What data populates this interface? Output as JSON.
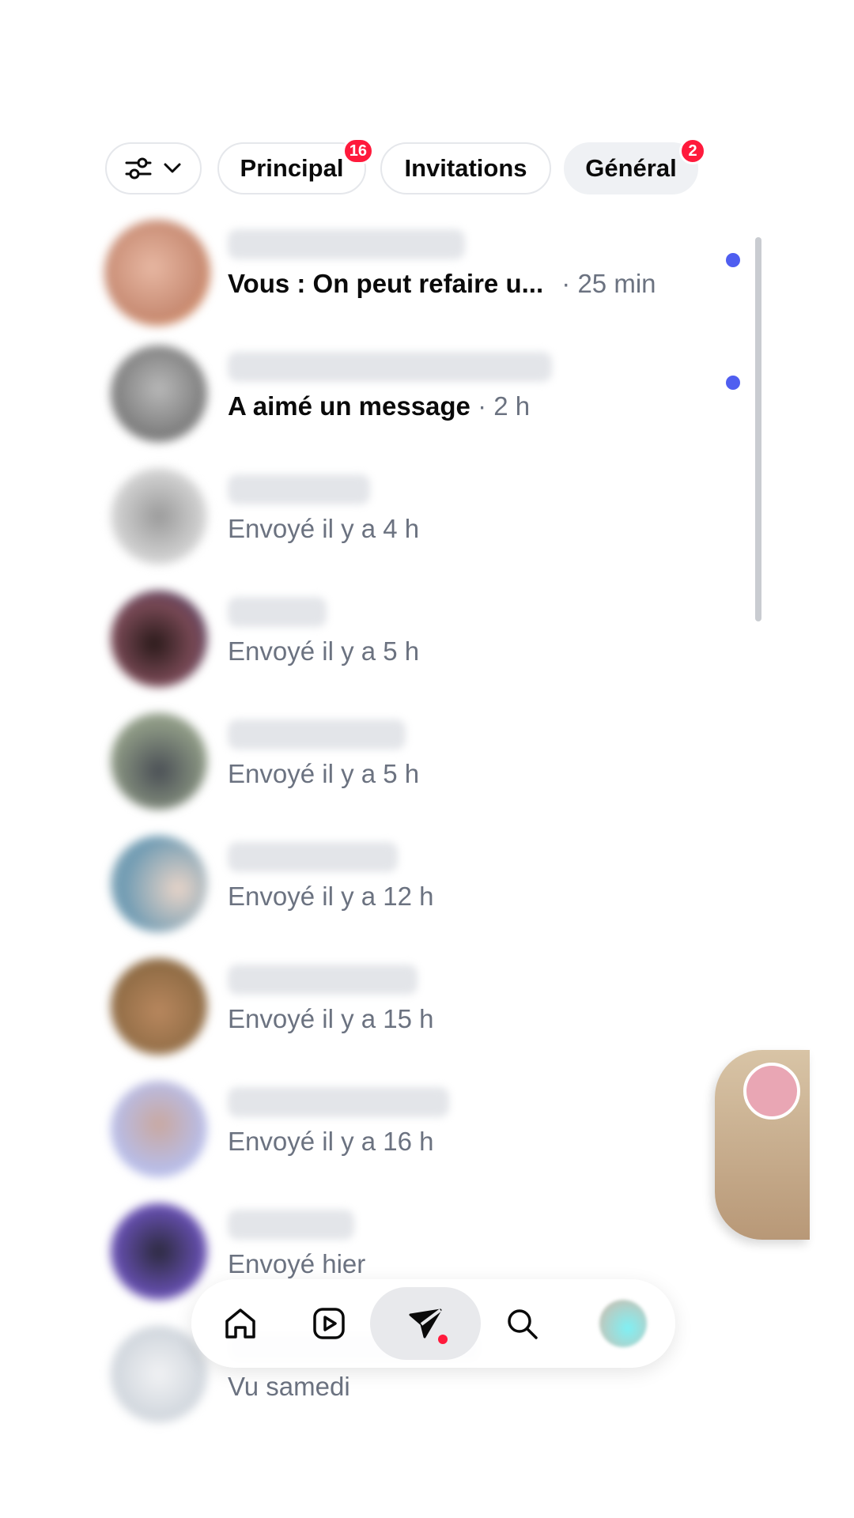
{
  "filters": {
    "filter_icon": "sliders-icon",
    "chevron_icon": "chevron-down-icon",
    "chips": [
      {
        "label": "Principal",
        "badge": "16"
      },
      {
        "label": "Invitations",
        "badge": ""
      },
      {
        "label": "Général",
        "badge": "2",
        "active": true
      }
    ]
  },
  "conversations": [
    {
      "preview": "Vous : On peut refaire u...",
      "time": " · 25 min",
      "unread": true,
      "avatar_color": "#d9a58e"
    },
    {
      "preview": "A aimé un message",
      "time": " · 2 h",
      "unread": true,
      "avatar_color": "#8f8f8f"
    },
    {
      "preview": "Envoyé il y a 4 h",
      "time": "",
      "unread": false,
      "avatar_color": "#bdbdbd"
    },
    {
      "preview": "Envoyé il y a 5 h",
      "time": "",
      "unread": false,
      "avatar_color": "#5a3a40"
    },
    {
      "preview": "Envoyé il y a 5 h",
      "time": "",
      "unread": false,
      "avatar_color": "#6f756c"
    },
    {
      "preview": "Envoyé il y a 12 h",
      "time": "",
      "unread": false,
      "avatar_color": "#7f98a8"
    },
    {
      "preview": "Envoyé il y a 15 h",
      "time": "",
      "unread": false,
      "avatar_color": "#a57b55"
    },
    {
      "preview": "Envoyé il y a 16 h",
      "time": "",
      "unread": false,
      "avatar_color": "#b6a7b0"
    },
    {
      "preview": "Envoyé hier",
      "time": "",
      "unread": false,
      "avatar_color": "#5b4a8c"
    },
    {
      "preview": "Vu samedi",
      "time": "",
      "unread": false,
      "avatar_color": "#d7dbe2"
    }
  ],
  "nav": {
    "items": [
      "home-icon",
      "reels-icon",
      "messages-icon",
      "search-icon",
      "profile-avatar"
    ],
    "active": "messages-icon"
  },
  "colors": {
    "unread_dot": "#4f5ef0",
    "badge": "#ff1a3c",
    "muted_text": "#6b7280"
  }
}
